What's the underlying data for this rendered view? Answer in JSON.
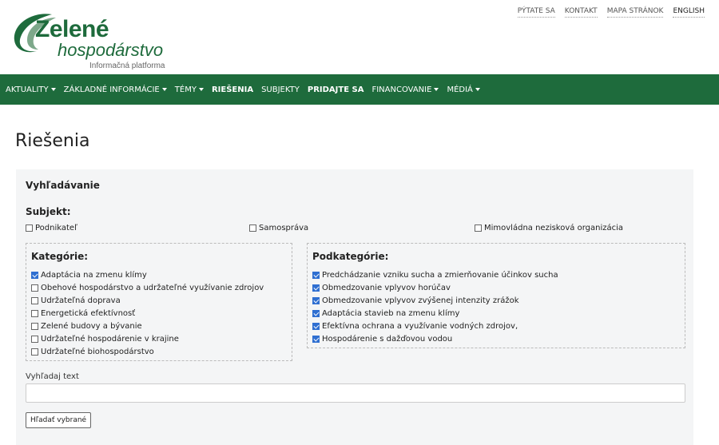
{
  "header": {
    "logo": {
      "main": "Zelené",
      "sub": "hospodárstvo",
      "tagline": "Informačná platforma"
    },
    "toplinks": [
      "PÝTATE SA",
      "KONTAKT",
      "MAPA STRÁNOK",
      "ENGLISH"
    ],
    "brand_color": "#1e6b3c"
  },
  "nav": {
    "items": [
      {
        "label": "AKTUALITY",
        "dropdown": true
      },
      {
        "label": "ZÁKLADNÉ INFORMÁCIE",
        "dropdown": true
      },
      {
        "label": "TÉMY",
        "dropdown": true
      },
      {
        "label": "RIEŠENIA",
        "dropdown": false,
        "active": true
      },
      {
        "label": "SUBJEKTY",
        "dropdown": false
      },
      {
        "label": "PRIDAJTE SA",
        "dropdown": false,
        "active": true
      },
      {
        "label": "FINANCOVANIE",
        "dropdown": true
      },
      {
        "label": "MÉDIÁ",
        "dropdown": true
      }
    ]
  },
  "page": {
    "title": "Riešenia"
  },
  "search": {
    "heading": "Vyhľadávanie",
    "subject_label": "Subjekt:",
    "subjects": [
      {
        "label": "Podnikateľ",
        "checked": false
      },
      {
        "label": "Samospráva",
        "checked": false
      },
      {
        "label": "Mimovládna nezisková organizácia",
        "checked": false
      }
    ],
    "categories_label": "Kategórie:",
    "categories": [
      {
        "label": "Adaptácia na zmenu klímy",
        "checked": true
      },
      {
        "label": "Obehové hospodárstvo a udržateľné využívanie zdrojov",
        "checked": false
      },
      {
        "label": "Udržateľná doprava",
        "checked": false
      },
      {
        "label": "Energetická efektívnosť",
        "checked": false
      },
      {
        "label": "Zelené budovy a bývanie",
        "checked": false
      },
      {
        "label": "Udržateľné hospodárenie v krajine",
        "checked": false
      },
      {
        "label": "Udržateľné biohospodárstvo",
        "checked": false
      }
    ],
    "subcategories_label": "Podkategórie:",
    "subcategories": [
      {
        "label": "Predchádzanie vzniku sucha a zmierňovanie účinkov sucha",
        "checked": true
      },
      {
        "label": "Obmedzovanie vplyvov horúčav",
        "checked": true
      },
      {
        "label": "Obmedzovanie vplyvov zvýšenej intenzity zrážok",
        "checked": true
      },
      {
        "label": "Adaptácia stavieb na zmenu klímy",
        "checked": true
      },
      {
        "label": "Efektívna ochrana a využívanie vodných zdrojov,",
        "checked": true
      },
      {
        "label": "Hospodárenie s dažďovou vodou",
        "checked": true
      }
    ],
    "text_label": "Vyhľadaj text",
    "text_value": "",
    "button_label": "Hľadať vybrané"
  }
}
